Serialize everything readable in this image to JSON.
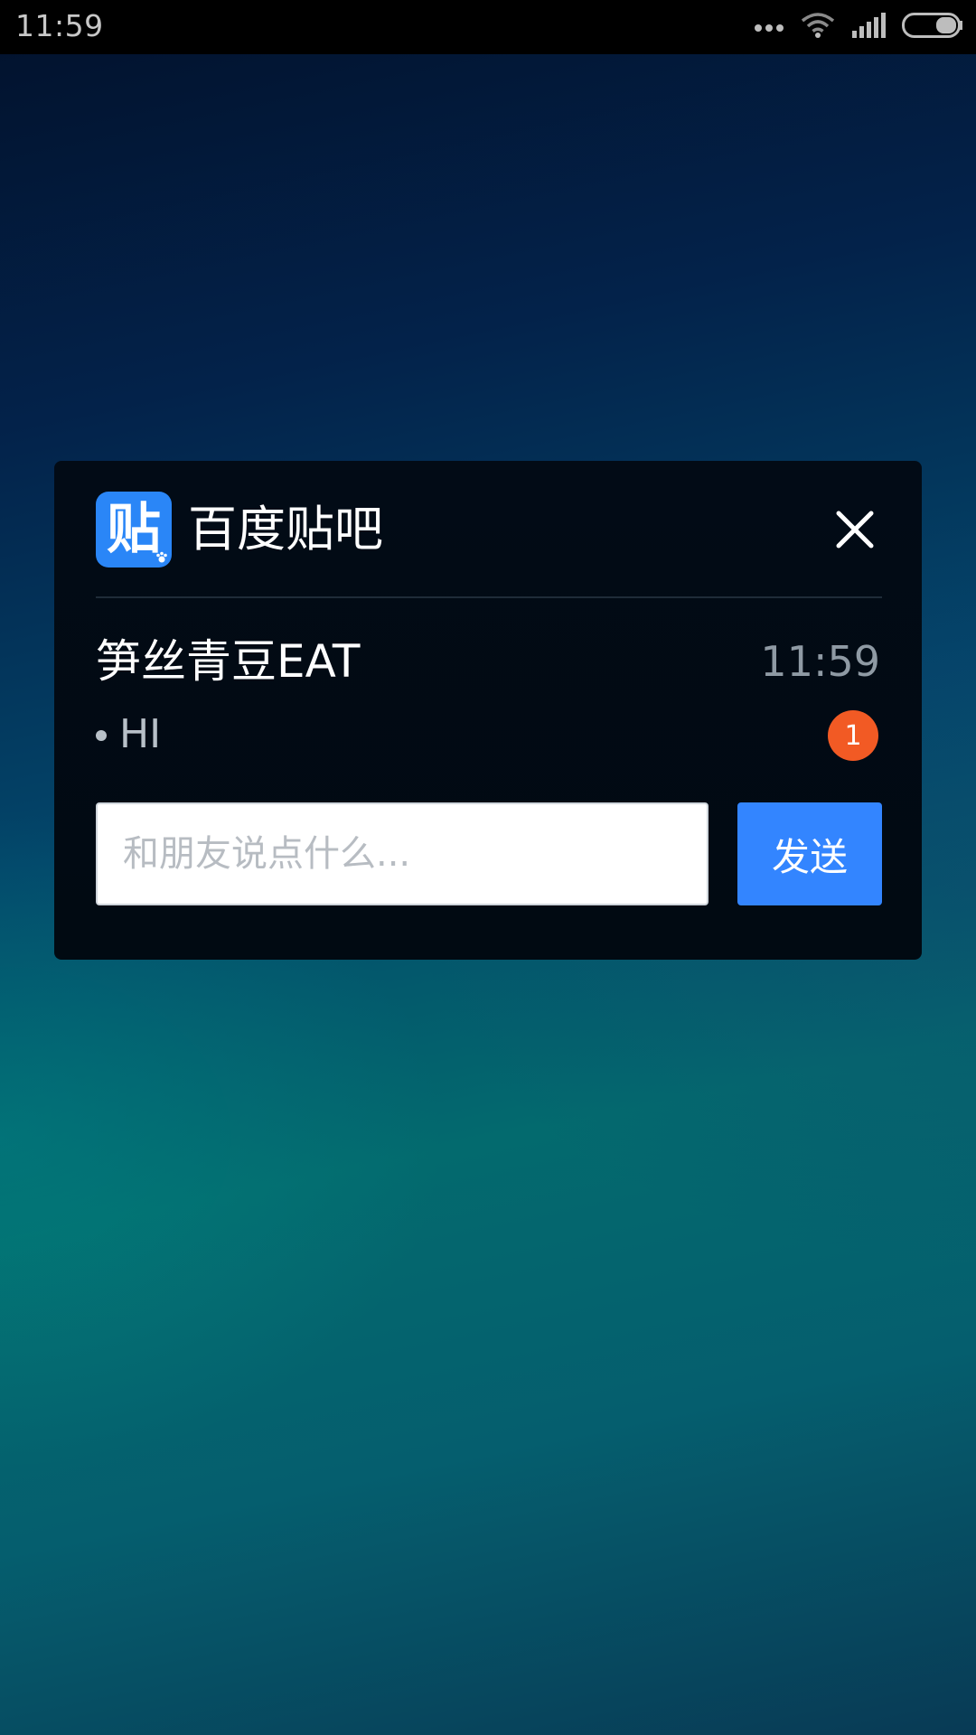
{
  "status_bar": {
    "time": "11:59",
    "icons": [
      "more-dots-icon",
      "wifi-icon",
      "signal-icon",
      "battery-icon"
    ]
  },
  "notification": {
    "app_name": "百度贴吧",
    "app_icon_glyph": "贴",
    "app_icon_color": "#2a86f7",
    "sender": "笋丝青豆EAT",
    "time": "11:59",
    "message": "HI",
    "unread_count": "1",
    "badge_color": "#f25a24",
    "reply": {
      "placeholder": "和朋友说点什么...",
      "value": ""
    },
    "send_label": "发送",
    "send_color": "#3385ff"
  }
}
